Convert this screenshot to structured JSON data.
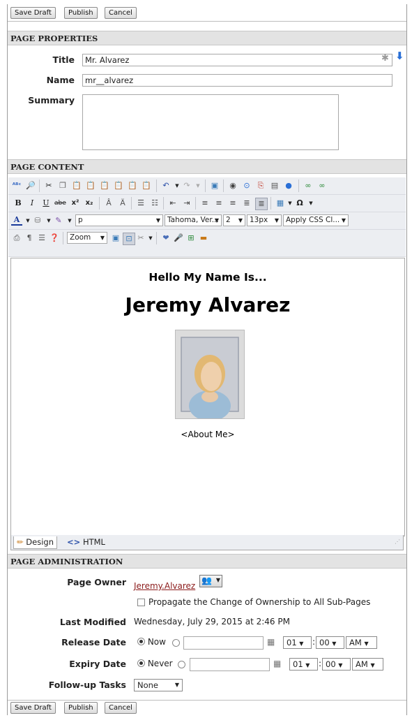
{
  "buttons": {
    "save_draft": "Save Draft",
    "publish": "Publish",
    "cancel": "Cancel"
  },
  "properties": {
    "heading": "PAGE PROPERTIES",
    "title_label": "Title",
    "title_value": "Mr. Alvarez",
    "name_label": "Name",
    "name_value": "mr__alvarez",
    "summary_label": "Summary",
    "summary_value": ""
  },
  "content": {
    "heading": "PAGE CONTENT",
    "format_select": "p",
    "font_select": "Tahoma, Ver...",
    "size_select": "2",
    "px_select": "13px",
    "css_select": "Apply CSS Cl...",
    "zoom_select": "Zoom",
    "editor_heading": "Hello My Name Is...",
    "editor_name": "Jeremy Alvarez",
    "editor_about": "<About Me>",
    "design_tab": "Design",
    "html_tab": "HTML",
    "format_buttons": [
      "B",
      "I",
      "U",
      "abe",
      "x²",
      "x₂"
    ]
  },
  "admin": {
    "heading": "PAGE ADMINISTRATION",
    "owner_label": "Page Owner",
    "owner_value": "Jeremy.Alvarez",
    "propagate_label": "Propagate the Change of Ownership to All Sub-Pages",
    "last_modified_label": "Last Modified",
    "last_modified_value": "Wednesday, July 29, 2015 at 2:46 PM",
    "release_label": "Release Date",
    "release_now": "Now",
    "expiry_label": "Expiry Date",
    "expiry_never": "Never",
    "hour": "01",
    "minute": "00",
    "ampm": "AM",
    "followup_label": "Follow-up Tasks",
    "followup_value": "None"
  },
  "colors": {
    "section_bg": "#e3e3e3",
    "link": "#8b1a1a",
    "toolbar_bg": "#eceef2"
  },
  "icons": [
    "spellcheck-icon",
    "find-icon",
    "cut-icon",
    "copy-icon",
    "paste-icon",
    "paste-text-icon",
    "paste-word-icon",
    "paste-html-icon",
    "undo-icon",
    "redo-icon",
    "image-icon",
    "flash-icon",
    "media-icon",
    "document-icon",
    "template-icon",
    "link-icon",
    "unlink-icon",
    "print-icon",
    "paragraph-icon",
    "align-icon",
    "help-icon",
    "table-icon",
    "special-char-icon",
    "font-color-icon",
    "highlight-icon",
    "clean-icon"
  ]
}
